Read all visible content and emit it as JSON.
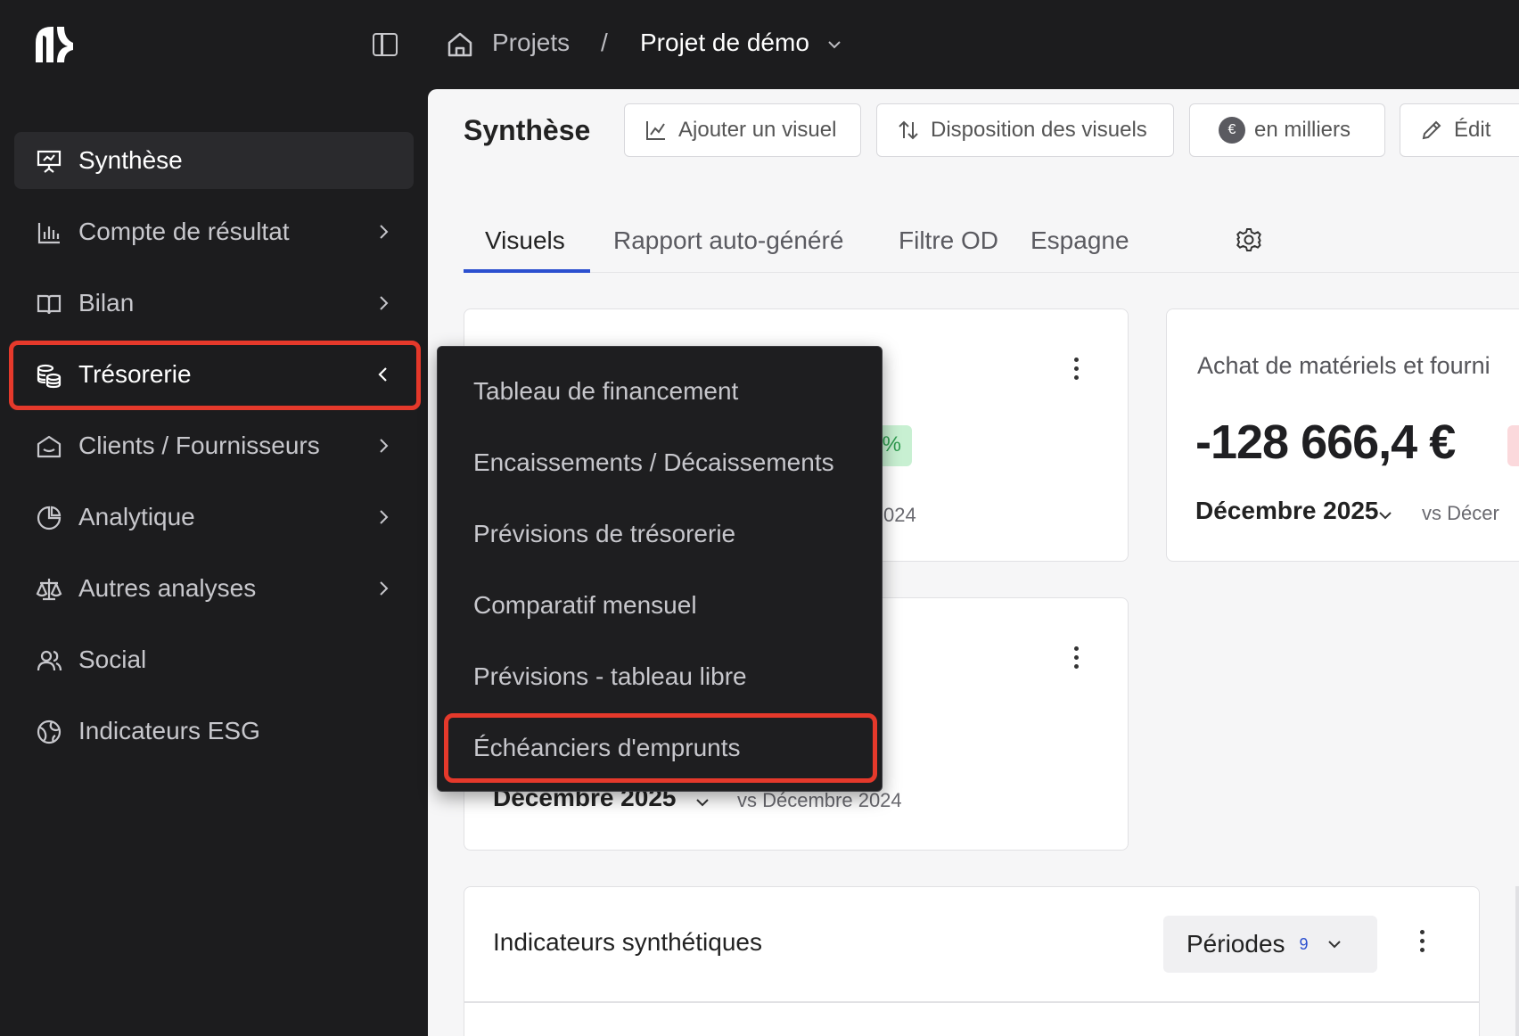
{
  "topbar": {
    "breadcrumb_projects": "Projets",
    "breadcrumb_separator": "/",
    "breadcrumb_current": "Projet de démo"
  },
  "sidebar": {
    "items": [
      {
        "label": "Synthèse",
        "icon": "presentation-icon",
        "active": true
      },
      {
        "label": "Compte de résultat",
        "icon": "bar-chart-icon",
        "has_children": true
      },
      {
        "label": "Bilan",
        "icon": "book-icon",
        "has_children": true
      },
      {
        "label": "Trésorerie",
        "icon": "coins-icon",
        "has_children": true,
        "expanded": true
      },
      {
        "label": "Clients / Fournisseurs",
        "icon": "house-icon",
        "has_children": true
      },
      {
        "label": "Analytique",
        "icon": "pie-chart-icon",
        "has_children": true
      },
      {
        "label": "Autres analyses",
        "icon": "scale-icon",
        "has_children": true
      },
      {
        "label": "Social",
        "icon": "users-icon"
      },
      {
        "label": "Indicateurs ESG",
        "icon": "globe-icon"
      }
    ]
  },
  "flyout": {
    "items": [
      "Tableau de financement",
      "Encaissements / Décaissements",
      "Prévisions de trésorerie",
      "Comparatif mensuel",
      "Prévisions - tableau libre",
      "Échéanciers d'emprunts"
    ],
    "highlighted_index": 5
  },
  "main": {
    "title": "Synthèse",
    "toolbar": {
      "add_visual": "Ajouter un visuel",
      "layout": "Disposition des visuels",
      "units_symbol": "€",
      "units": "en milliers",
      "edit": "Édit"
    },
    "tabs": [
      "Visuels",
      "Rapport auto-généré",
      "Filtre OD",
      "Espagne"
    ],
    "active_tab": 0,
    "cards": {
      "card1": {
        "compare_tail": "024",
        "badge_tail": "%",
        "badge_color": "#c8f0d2"
      },
      "card2": {
        "title": "Achat de matériels et fourni",
        "value": "-128 666,4 €",
        "period": "Décembre 2025",
        "compare": "vs Décer",
        "badge_color": "#fbd9dc"
      },
      "card3": {
        "period": "Décembre 2025",
        "compare": "vs Décembre 2024"
      }
    },
    "indicators": {
      "title": "Indicateurs synthétiques",
      "periods_label": "Périodes",
      "periods_count": "9"
    }
  },
  "colors": {
    "highlight": "#e5392b",
    "accent": "#2b4fcf",
    "sidebar_bg": "#1c1c1e",
    "main_bg": "#f6f6f7"
  }
}
